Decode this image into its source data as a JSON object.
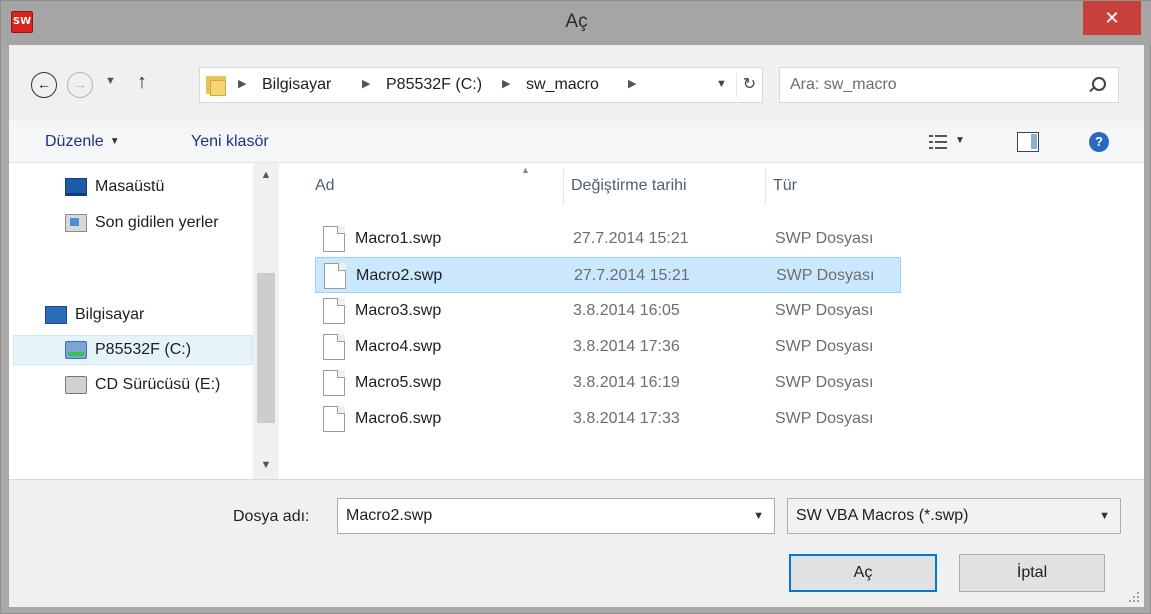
{
  "window": {
    "title": "Aç",
    "app_icon_text": "SW",
    "close_glyph": "✕"
  },
  "address": {
    "crumbs": [
      "Bilgisayar",
      "P85532F (C:)",
      "sw_macro"
    ],
    "search_placeholder": "Ara: sw_macro"
  },
  "toolbar": {
    "organize_label": "Düzenle",
    "new_folder_label": "Yeni klasör"
  },
  "nav": {
    "items": [
      {
        "label": "Masaüstü",
        "icon": "desktop-icon"
      },
      {
        "label": "Son gidilen yerler",
        "icon": "recent-places-icon"
      },
      {
        "label": "Bilgisayar",
        "icon": "computer-icon"
      },
      {
        "label": "P85532F (C:)",
        "icon": "drive-icon"
      },
      {
        "label": "CD Sürücüsü (E:)",
        "icon": "cd-drive-icon"
      }
    ]
  },
  "files": {
    "columns": [
      "Ad",
      "Değiştirme tarihi",
      "Tür"
    ],
    "rows": [
      {
        "name": "Macro1.swp",
        "date": "27.7.2014 15:21",
        "type": "SWP Dosyası"
      },
      {
        "name": "Macro2.swp",
        "date": "27.7.2014 15:21",
        "type": "SWP Dosyası"
      },
      {
        "name": "Macro3.swp",
        "date": "3.8.2014 16:05",
        "type": "SWP Dosyası"
      },
      {
        "name": "Macro4.swp",
        "date": "3.8.2014 17:36",
        "type": "SWP Dosyası"
      },
      {
        "name": "Macro5.swp",
        "date": "3.8.2014 16:19",
        "type": "SWP Dosyası"
      },
      {
        "name": "Macro6.swp",
        "date": "3.8.2014 17:33",
        "type": "SWP Dosyası"
      }
    ],
    "selected_index": 1
  },
  "bottom": {
    "filename_label": "Dosya adı:",
    "filename_value": "Macro2.swp",
    "filter_value": "SW VBA Macros (*.swp)",
    "open_label": "Aç",
    "cancel_label": "İptal"
  },
  "colors": {
    "accent": "#0078d7",
    "selection": "#cce8ff",
    "close": "#c7403a"
  }
}
